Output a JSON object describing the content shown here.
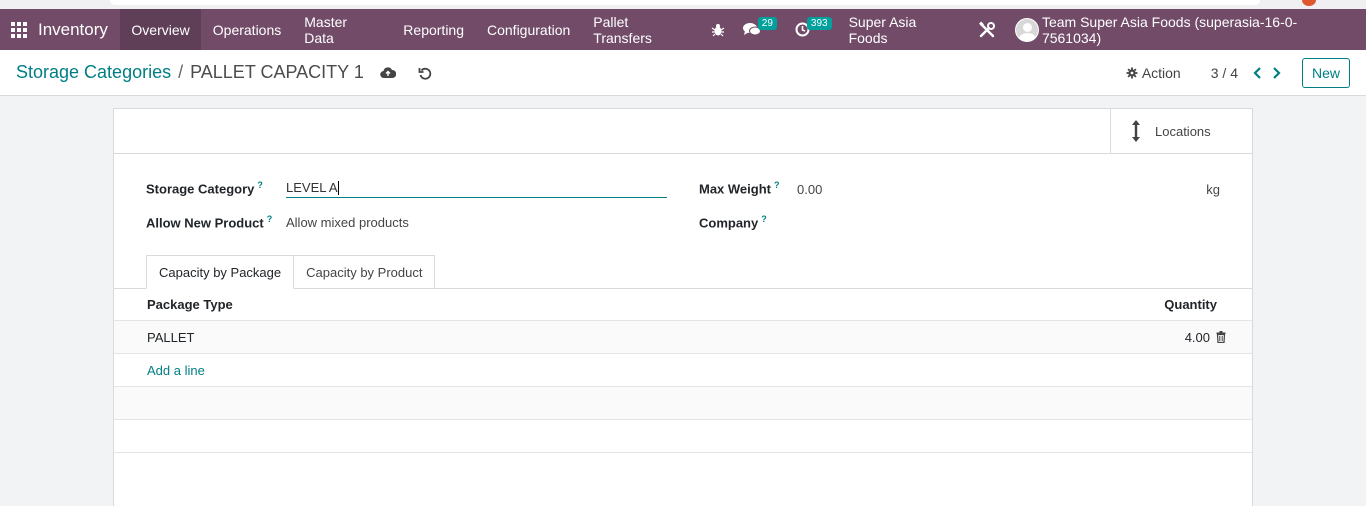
{
  "navbar": {
    "app_name": "Inventory",
    "menu": [
      "Overview",
      "Operations",
      "Master Data",
      "Reporting",
      "Configuration",
      "Pallet Transfers"
    ],
    "active_menu": "Overview",
    "messages_count": "29",
    "activities_count": "393",
    "company": "Super Asia Foods",
    "user": "Team Super Asia Foods (superasia-16-0-7561034)"
  },
  "control": {
    "breadcrumb_parent": "Storage Categories",
    "breadcrumb_separator": "/",
    "breadcrumb_current": "PALLET CAPACITY 1",
    "action_label": "Action",
    "pager": "3 / 4",
    "new_label": "New"
  },
  "form": {
    "stat_button_label": "Locations",
    "storage_category_label": "Storage Category",
    "storage_category_value": "LEVEL A",
    "allow_new_product_label": "Allow New Product",
    "allow_new_product_value": "Allow mixed products",
    "max_weight_label": "Max Weight",
    "max_weight_value": "0.00",
    "max_weight_unit": "kg",
    "company_label": "Company",
    "help_mark": "?",
    "tabs": [
      "Capacity by Package",
      "Capacity by Product"
    ],
    "table": {
      "headers": [
        "Package Type",
        "Quantity"
      ],
      "rows": [
        {
          "package_type": "PALLET",
          "quantity": "4.00"
        }
      ],
      "add_line": "Add a line"
    }
  },
  "colors": {
    "navbar": "#714b67",
    "accent": "#017e84",
    "badge": "#00a09d"
  }
}
